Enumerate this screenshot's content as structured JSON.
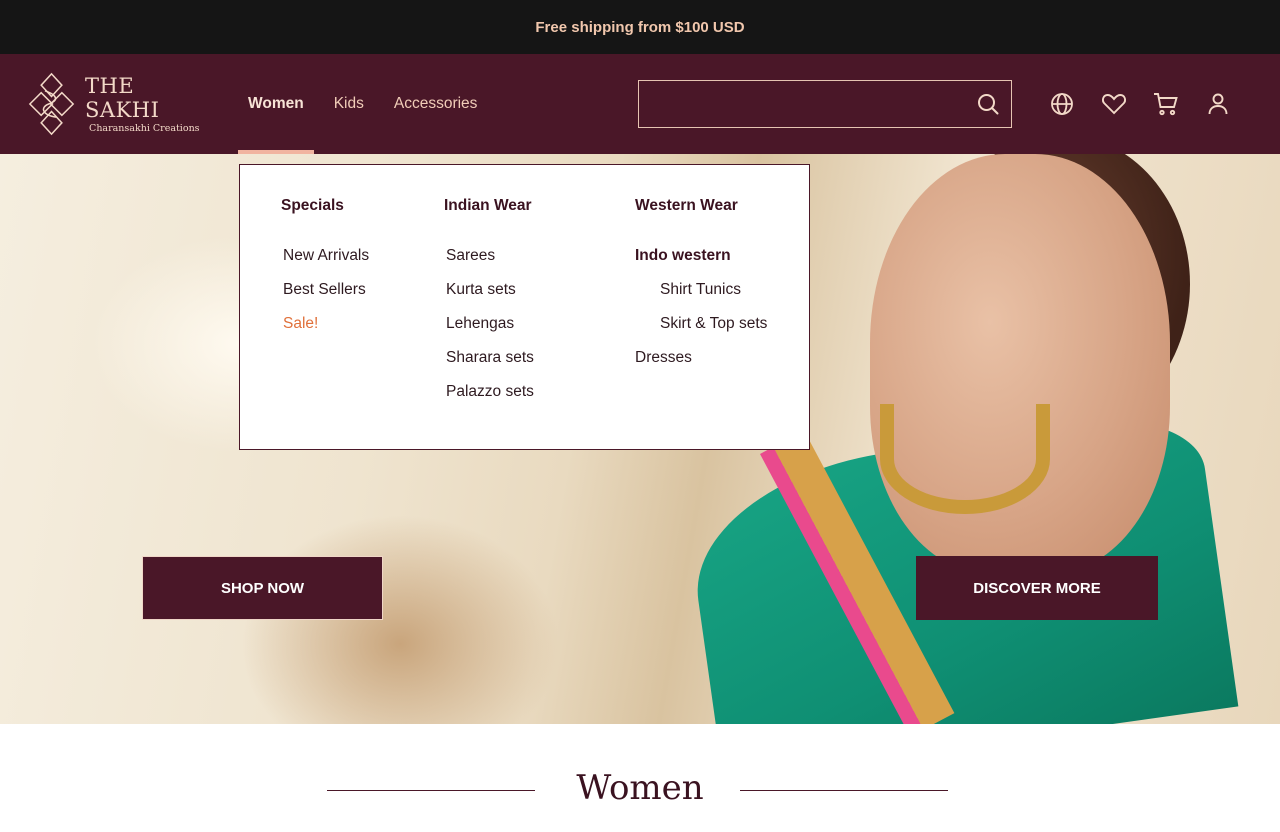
{
  "announcement": "Free shipping from $100 USD",
  "brand": {
    "title": "THE SAKHI",
    "subtitle": "Charansakhi Creations"
  },
  "nav": {
    "items": [
      {
        "label": "Women"
      },
      {
        "label": "Kids"
      },
      {
        "label": "Accessories"
      }
    ],
    "active": "Women"
  },
  "search": {
    "value": "",
    "placeholder": ""
  },
  "header_icons": [
    "globe-icon",
    "heart-icon",
    "cart-icon",
    "user-icon"
  ],
  "mega_menu": {
    "specials": {
      "heading": "Specials",
      "links": [
        "New Arrivals",
        "Best Sellers",
        "Sale!"
      ]
    },
    "indian": {
      "heading": "Indian Wear",
      "links": [
        "Sarees",
        "Kurta sets",
        "Lehengas",
        "Sharara sets",
        "Palazzo sets"
      ]
    },
    "western": {
      "heading": "Western Wear",
      "subheading": "Indo western",
      "sublinks": [
        "Shirt Tunics",
        "Skirt & Top sets"
      ],
      "links": [
        "Dresses"
      ]
    }
  },
  "hero": {
    "primary_cta": "SHOP NOW",
    "secondary_cta": "DISCOVER MORE"
  },
  "section": {
    "title": "Women"
  },
  "colors": {
    "brand": "#4a1728",
    "accent": "#f1b4a0",
    "sale": "#e0703a",
    "announce_bg": "#151515"
  }
}
